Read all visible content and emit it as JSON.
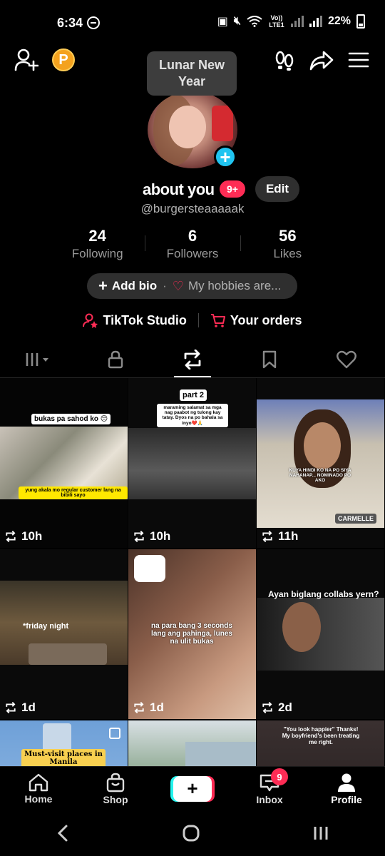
{
  "status_bar": {
    "time": "6:34",
    "network": "Vo)) LTE1",
    "battery": "22%"
  },
  "tooltip": {
    "text": "Lunar New Year"
  },
  "coin_label": "P",
  "profile": {
    "name": "about you",
    "badge": "9+",
    "edit_label": "Edit",
    "handle": "@burgersteaaaaak",
    "stats": [
      {
        "value": "24",
        "label": "Following"
      },
      {
        "value": "6",
        "label": "Followers"
      },
      {
        "value": "56",
        "label": "Likes"
      }
    ],
    "bio_add": "Add bio",
    "bio_hobbies": "My hobbies are...",
    "links": [
      {
        "label": "TikTok Studio",
        "icon": "studio-user-icon"
      },
      {
        "label": "Your orders",
        "icon": "cart-icon"
      }
    ]
  },
  "tabs": [
    "grid-menu-icon",
    "lock-icon",
    "repost-icon",
    "bookmark-icon",
    "heart-icon"
  ],
  "videos": [
    {
      "time": "10h",
      "caption": "bukas pa sahod ko 😔",
      "subcaption": "yung akala mo regular customer lang na bibili sayo"
    },
    {
      "time": "10h",
      "caption": "part 2",
      "subcaption": "maraming salamat sa mga nag paabot ng tulong kay tatay. Dyos na po bahala sa inyo❤️🙏"
    },
    {
      "time": "11h",
      "caption": "CARMELLE",
      "subcaption": "KUYA HINDI KO NA PO SIYA NAHANAP... NOMINADO PO AKO"
    },
    {
      "time": "1d",
      "caption": "*friday night",
      "subcaption": ""
    },
    {
      "time": "1d",
      "caption": "na para bang 3 seconds lang ang pahinga, lunes na ulit bukas",
      "subcaption": ""
    },
    {
      "time": "2d",
      "caption": "Ayan biglang collabs yern?",
      "subcaption": ""
    },
    {
      "time": "",
      "caption": "Must-visit places in Manila",
      "subcaption": ""
    },
    {
      "time": "",
      "caption": "",
      "subcaption": ""
    },
    {
      "time": "",
      "caption": "\"You look happier\" Thanks! My boyfriend's been treating me right.",
      "subcaption": ""
    }
  ],
  "nav": {
    "home": "Home",
    "shop": "Shop",
    "create": "+",
    "inbox": "Inbox",
    "inbox_badge": "9",
    "profile": "Profile"
  }
}
